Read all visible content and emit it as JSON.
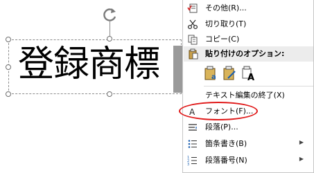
{
  "slide": {
    "text": "登録商標"
  },
  "menu": {
    "other": "その他(R)...",
    "cut": "切り取り(T)",
    "copy": "コピー(C)",
    "paste_options_header": "貼り付けのオプション:",
    "end_text_edit": "テキスト編集の終了(X)",
    "font": "フォント(F)...",
    "paragraph": "段落(P)...",
    "bullets": "箇条書き(B)",
    "numbering": "段落番号(N)"
  },
  "icons": {
    "other": "spellcheck-icon",
    "cut": "scissors-icon",
    "copy": "copy-icon",
    "paste": "paste-icon",
    "font": "font-icon",
    "paragraph": "paragraph-icon",
    "bullets": "bullets-icon",
    "numbering": "numbering-icon"
  },
  "colors": {
    "highlight": "#e01919",
    "menu_border": "#c6c6c6",
    "header_bg": "#ececec"
  }
}
